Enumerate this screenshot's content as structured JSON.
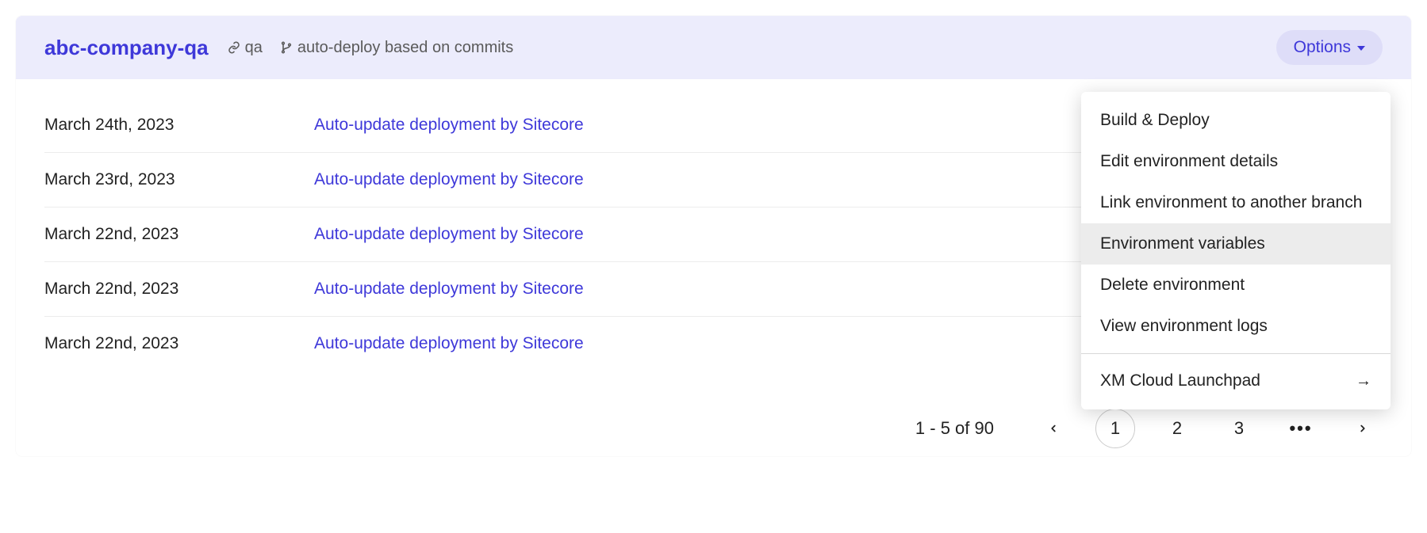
{
  "header": {
    "env_name": "abc-company-qa",
    "branch": "qa",
    "deploy_mode": "auto-deploy based on commits",
    "options_label": "Options"
  },
  "dropdown": {
    "items": [
      {
        "label": "Build & Deploy",
        "hover": false
      },
      {
        "label": "Edit environment details",
        "hover": false
      },
      {
        "label": "Link environment to another branch",
        "hover": false
      },
      {
        "label": "Environment variables",
        "hover": true
      },
      {
        "label": "Delete environment",
        "hover": false
      },
      {
        "label": "View environment logs",
        "hover": false
      }
    ],
    "footer_label": "XM Cloud Launchpad"
  },
  "deployments": [
    {
      "date": "March 24th, 2023",
      "desc": "Auto-update deployment by Sitecore"
    },
    {
      "date": "March 23rd, 2023",
      "desc": "Auto-update deployment by Sitecore"
    },
    {
      "date": "March 22nd, 2023",
      "desc": "Auto-update deployment by Sitecore"
    },
    {
      "date": "March 22nd, 2023",
      "desc": "Auto-update deployment by Sitecore"
    },
    {
      "date": "March 22nd, 2023",
      "desc": "Auto-update deployment by Sitecore"
    }
  ],
  "pagination": {
    "range": "1 - 5 of 90",
    "pages": [
      "1",
      "2",
      "3"
    ],
    "active_index": 0
  }
}
